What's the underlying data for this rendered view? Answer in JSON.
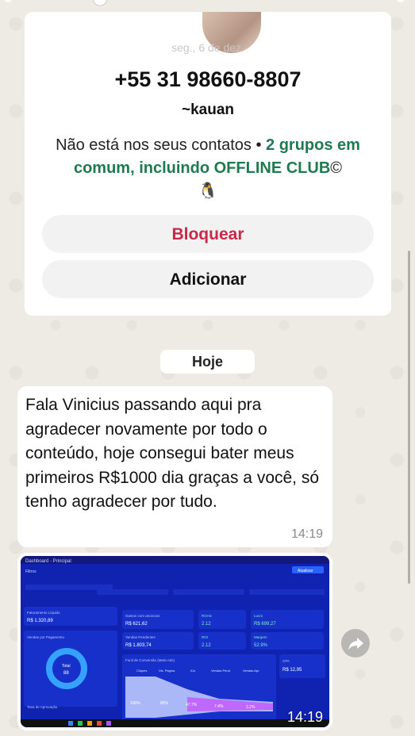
{
  "contact_card": {
    "faded_date": "seg., 6 de dez.",
    "phone": "+55 31 98660-8807",
    "nickname": "~kauan",
    "not_in_contacts": "Não está nos seus contatos",
    "separator": " • ",
    "groups_text": "2 grupos em comum, incluindo OFFLINE CLUB",
    "emoji_after_group": "©",
    "emoji_penguin": "🐧",
    "block_label": "Bloquear",
    "add_label": "Adicionar"
  },
  "chat": {
    "day_label": "Hoje",
    "messages": [
      {
        "text": "Fala Vinicius passando aqui pra agradecer novamente por todo o conteúdo, hoje consegui bater meus primeiros R$1000 dia graças a você, só tenho agradecer por tudo.",
        "time": "14:19"
      },
      {
        "type": "image",
        "time": "14:19",
        "dashboard": {
          "title": "Dashboard - Principal",
          "filters": "Filtros",
          "update_btn": "Atualizar",
          "tiles": [
            {
              "label": "Faturamento Líquido",
              "value": "R$ 1.320,89"
            },
            {
              "label": "Gastos com anúncios",
              "value": "R$ 621,62"
            },
            {
              "label": "ROAS",
              "value": "2.12"
            },
            {
              "label": "Lucro",
              "value": "R$ 699,27"
            },
            {
              "label": "Vendas Pendentes",
              "value": "R$ 1.803,74"
            },
            {
              "label": "ROI",
              "value": "2.12"
            },
            {
              "label": "Margem",
              "value": "52.9%"
            },
            {
              "label": "CPA",
              "value": "R$ 12,95"
            }
          ],
          "donut_label": "Total",
          "donut_value": "88",
          "sales_title": "Vendas por Pagamento",
          "funnel_title": "Funil de Conversão (Meta Ads)",
          "funnel_cols": [
            "Cliques",
            "Vis. Página",
            "ICs",
            "Vendas Pend.",
            "Vendas Apr."
          ],
          "funnel_values": [
            "100%",
            "85%",
            "47.7%",
            "7.4%",
            "3.2%"
          ],
          "approval_rate": "Taxa de Aprovação"
        }
      }
    ]
  },
  "colors": {
    "block_red": "#c8284a",
    "group_green": "#1f7a4f",
    "dashboard_blue": "#0d1fa6"
  }
}
